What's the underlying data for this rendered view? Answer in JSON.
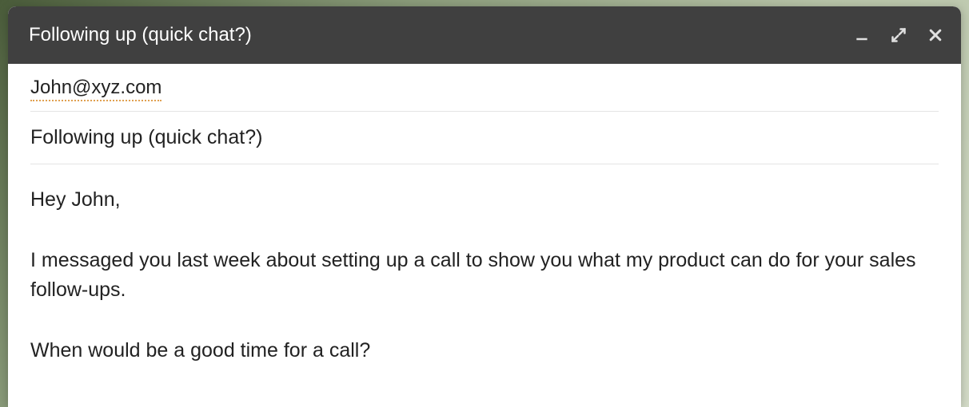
{
  "titlebar": {
    "title": "Following up (quick chat?)"
  },
  "compose": {
    "recipient": "John@xyz.com",
    "subject": "Following up (quick chat?)",
    "greeting": "Hey John,",
    "paragraph1": "I messaged you last week about setting up a call to show you what my product can do for your sales follow-ups.",
    "paragraph2": "When would be a good time for a call?"
  }
}
